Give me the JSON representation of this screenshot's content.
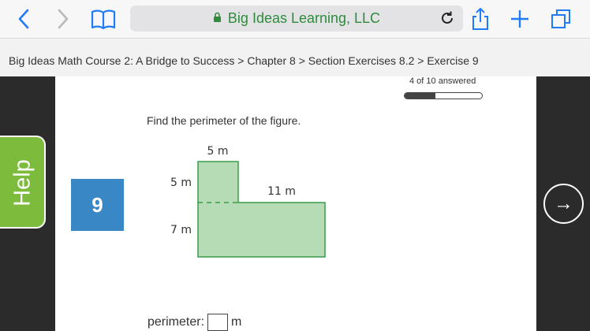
{
  "browser": {
    "url_title": "Big Ideas Learning, LLC",
    "icons": [
      "back-icon",
      "forward-icon",
      "bookmarks-icon",
      "lock-icon",
      "reload-icon",
      "share-icon",
      "new-tab-icon",
      "tabs-icon"
    ]
  },
  "breadcrumb": "Big Ideas Math Course 2: A Bridge to Success > Chapter 8 > Section Exercises 8.2 > Exercise 9",
  "progress": {
    "label": "4 of 10 answered",
    "answered": 4,
    "total": 10
  },
  "sidebar": {
    "help_label": "Help",
    "next_icon": "→"
  },
  "question": {
    "number": "9",
    "prompt": "Find the perimeter of the figure."
  },
  "figure": {
    "labels": {
      "top_width": "5 m",
      "left_upper": "5 m",
      "left_lower": "7 m",
      "right_top": "11 m"
    },
    "fill_color": "#b5dcb5",
    "stroke_color": "#3d9b4a"
  },
  "answer": {
    "label": "perimeter:",
    "unit": "m",
    "value": ""
  },
  "colors": {
    "help_green": "#7dbb3d",
    "question_blue": "#3a87c6",
    "url_green": "#2f8a3e",
    "ios_blue": "#1f7cf6"
  }
}
